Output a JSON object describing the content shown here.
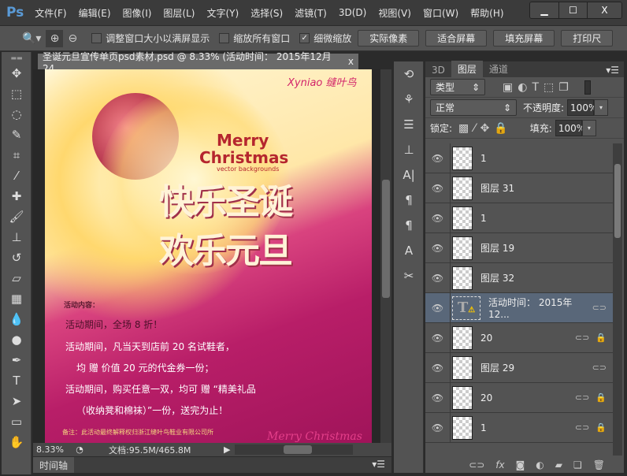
{
  "app": {
    "logo": "Ps",
    "menus": [
      "文件(F)",
      "编辑(E)",
      "图像(I)",
      "图层(L)",
      "文字(Y)",
      "选择(S)",
      "滤镜(T)",
      "3D(D)",
      "视图(V)",
      "窗口(W)",
      "帮助(H)"
    ],
    "window_controls": [
      "▁",
      "☐",
      "X"
    ]
  },
  "options": {
    "resize_windows": "调整窗口大小以满屏显示",
    "zoom_all": "缩放所有窗口",
    "scrubby_zoom": "细微缩放",
    "scrubby_checked": true,
    "buttons": [
      "实际像素",
      "适合屏幕",
      "填充屏幕",
      "打印尺"
    ]
  },
  "document": {
    "tab_title": "圣诞元旦宣传单页psd素材.psd @ 8.33% (活动时间： 2015年12月24...",
    "close": "x",
    "zoom": "8.33%",
    "doc_size": "文档:95.5M/465.8M"
  },
  "poster": {
    "brand": "Xyniao 缝叶鸟",
    "merry": "Merry",
    "christmas": "Christmas",
    "vector": "vector backgrounds",
    "title1": "快乐圣诞",
    "title2": "欢乐元旦",
    "heading": "活动内容：",
    "lines": [
      "活动期间，全场 8 折！",
      "活动期间，凡当天到店前 20 名试鞋者，",
      "均 赠 价值 20 元的代金券一份；",
      "活动期间，购买任意一双，均可 赠 “精美礼品",
      "（收纳凳和棉袜）”一份，送完为止！"
    ],
    "note": "备注：此活动最终解释权归浙江缝叶鸟鞋业有限公司所",
    "footer_script": "Merry Christmas"
  },
  "timeline": {
    "label": "时间轴"
  },
  "layers_panel": {
    "tabs": [
      "3D",
      "图层",
      "通道"
    ],
    "active_tab": "图层",
    "filter": "类型",
    "blend_mode": "正常",
    "opacity_label": "不透明度:",
    "opacity": "100%",
    "lock_label": "锁定:",
    "fill_label": "填充:",
    "fill": "100%",
    "layers": [
      {
        "name": "1"
      },
      {
        "name": "图层 31"
      },
      {
        "name": "1"
      },
      {
        "name": "图层 19"
      },
      {
        "name": "图层 32"
      },
      {
        "name": "活动时间：  2015年12...",
        "type": "text",
        "selected": true,
        "linked": true
      },
      {
        "name": "20",
        "linked": true,
        "locked": true
      },
      {
        "name": "图层 29",
        "linked": true
      },
      {
        "name": "20",
        "linked": true,
        "locked": true
      },
      {
        "name": "1",
        "linked": true,
        "locked": true
      }
    ]
  },
  "colors": {
    "selection": "#596779",
    "panel": "#535353",
    "accent_magenta": "#b81e68"
  }
}
